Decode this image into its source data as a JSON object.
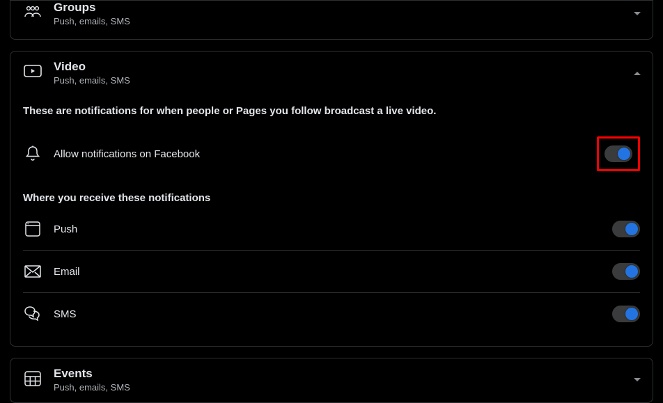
{
  "panels": {
    "groups": {
      "title": "Groups",
      "sub": "Push, emails, SMS"
    },
    "video": {
      "title": "Video",
      "sub": "Push, emails, SMS",
      "description": "These are notifications for when people or Pages you follow broadcast a live video.",
      "allow_label": "Allow notifications on Facebook",
      "where_heading": "Where you receive these notifications",
      "channels": {
        "push": "Push",
        "email": "Email",
        "sms": "SMS"
      }
    },
    "events": {
      "title": "Events",
      "sub": "Push, emails, SMS"
    }
  }
}
